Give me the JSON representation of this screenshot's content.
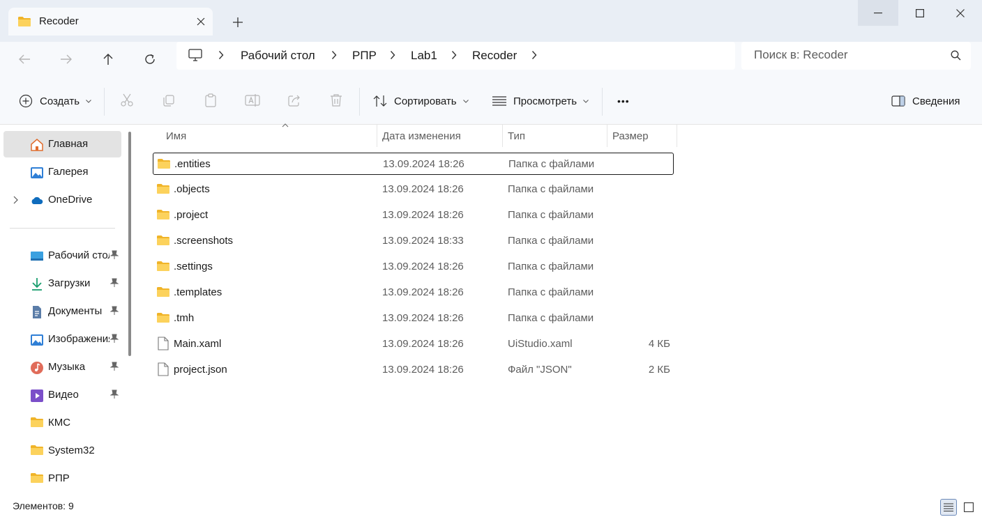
{
  "window": {
    "tab_title": "Recoder"
  },
  "nav": {
    "breadcrumbs": [
      "Рабочий стол",
      "РПР",
      "Lab1",
      "Recoder"
    ],
    "search_placeholder": "Поиск в: Recoder"
  },
  "toolbar": {
    "create_label": "Создать",
    "sort_label": "Сортировать",
    "view_label": "Просмотреть",
    "more_label": "•••",
    "details_label": "Сведения"
  },
  "sidebar": {
    "items": [
      {
        "label": "Главная",
        "icon": "home-icon"
      },
      {
        "label": "Галерея",
        "icon": "gallery-icon"
      },
      {
        "label": "OneDrive",
        "icon": "onedrive-icon"
      },
      {
        "label": "Рабочий стол",
        "icon": "desktop-icon"
      },
      {
        "label": "Загрузки",
        "icon": "downloads-icon"
      },
      {
        "label": "Документы",
        "icon": "documents-icon"
      },
      {
        "label": "Изображения",
        "icon": "pictures-icon"
      },
      {
        "label": "Музыка",
        "icon": "music-icon"
      },
      {
        "label": "Видео",
        "icon": "video-icon"
      },
      {
        "label": "КМС",
        "icon": "folder-icon"
      },
      {
        "label": "System32",
        "icon": "folder-icon"
      },
      {
        "label": "РПР",
        "icon": "folder-icon"
      }
    ]
  },
  "table": {
    "columns": [
      "Имя",
      "Дата изменения",
      "Тип",
      "Размер"
    ],
    "rows": [
      {
        "name": ".entities",
        "date": "13.09.2024 18:26",
        "type": "Папка с файлами",
        "size": "",
        "icon": "folder-icon"
      },
      {
        "name": ".objects",
        "date": "13.09.2024 18:26",
        "type": "Папка с файлами",
        "size": "",
        "icon": "folder-icon"
      },
      {
        "name": ".project",
        "date": "13.09.2024 18:26",
        "type": "Папка с файлами",
        "size": "",
        "icon": "folder-icon"
      },
      {
        "name": ".screenshots",
        "date": "13.09.2024 18:33",
        "type": "Папка с файлами",
        "size": "",
        "icon": "folder-icon"
      },
      {
        "name": ".settings",
        "date": "13.09.2024 18:26",
        "type": "Папка с файлами",
        "size": "",
        "icon": "folder-icon"
      },
      {
        "name": ".templates",
        "date": "13.09.2024 18:26",
        "type": "Папка с файлами",
        "size": "",
        "icon": "folder-icon"
      },
      {
        "name": ".tmh",
        "date": "13.09.2024 18:26",
        "type": "Папка с файлами",
        "size": "",
        "icon": "folder-icon"
      },
      {
        "name": "Main.xaml",
        "date": "13.09.2024 18:26",
        "type": "UiStudio.xaml",
        "size": "4 КБ",
        "icon": "file-icon"
      },
      {
        "name": "project.json",
        "date": "13.09.2024 18:26",
        "type": "Файл \"JSON\"",
        "size": "2 КБ",
        "icon": "file-icon"
      }
    ]
  },
  "status": {
    "count": "Элементов: 9"
  },
  "colors": {
    "folder": "#f5c542",
    "accent": "#0067c0",
    "titlebar": "#e9eef5"
  }
}
